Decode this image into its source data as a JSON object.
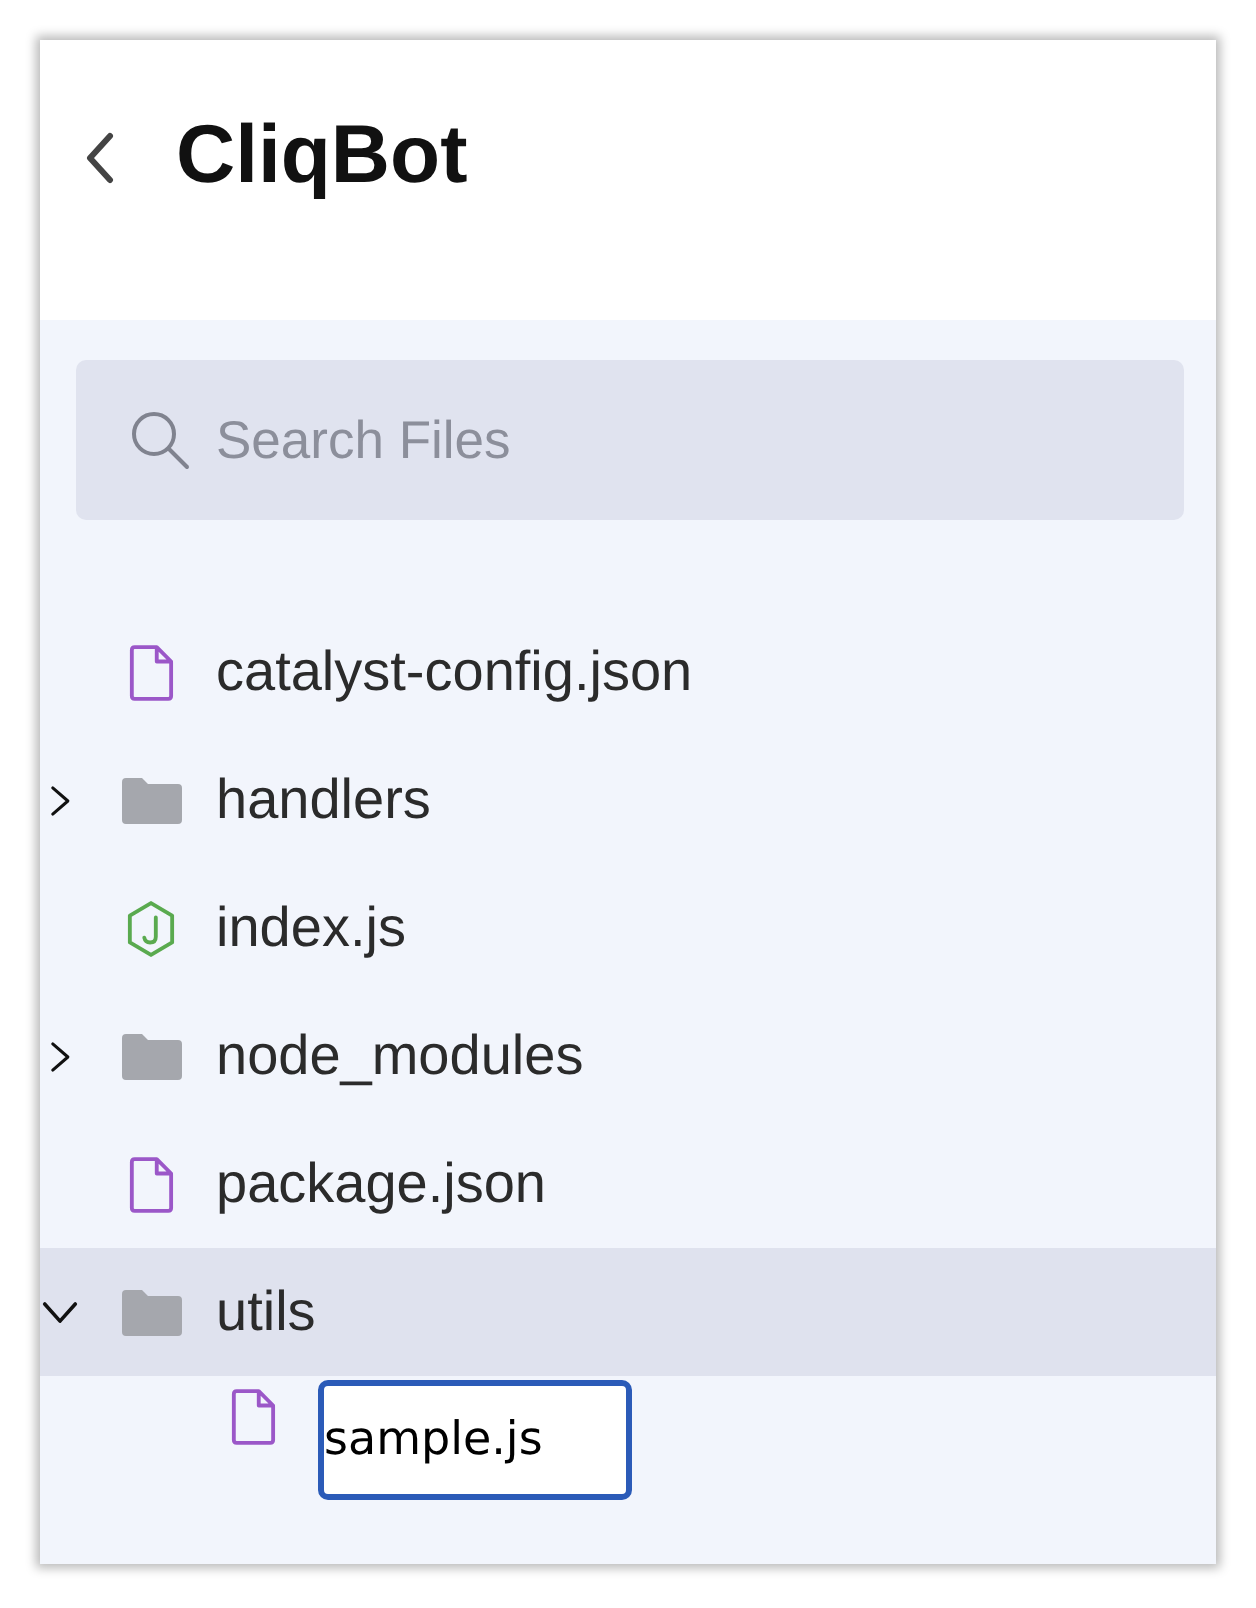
{
  "header": {
    "title": "CliqBot"
  },
  "search": {
    "placeholder": "Search Files"
  },
  "tree": [
    {
      "kind": "file",
      "name": "catalyst-config.json",
      "selected": false
    },
    {
      "kind": "folder",
      "name": "handlers",
      "expanded": false,
      "selected": false
    },
    {
      "kind": "node",
      "name": "index.js",
      "selected": false
    },
    {
      "kind": "folder",
      "name": "node_modules",
      "expanded": false,
      "selected": false
    },
    {
      "kind": "file",
      "name": "package.json",
      "selected": false
    },
    {
      "kind": "folder",
      "name": "utils",
      "expanded": true,
      "selected": true,
      "children": [
        {
          "kind": "file",
          "name": "sample.js",
          "renaming": true,
          "selected": false
        }
      ]
    }
  ]
}
